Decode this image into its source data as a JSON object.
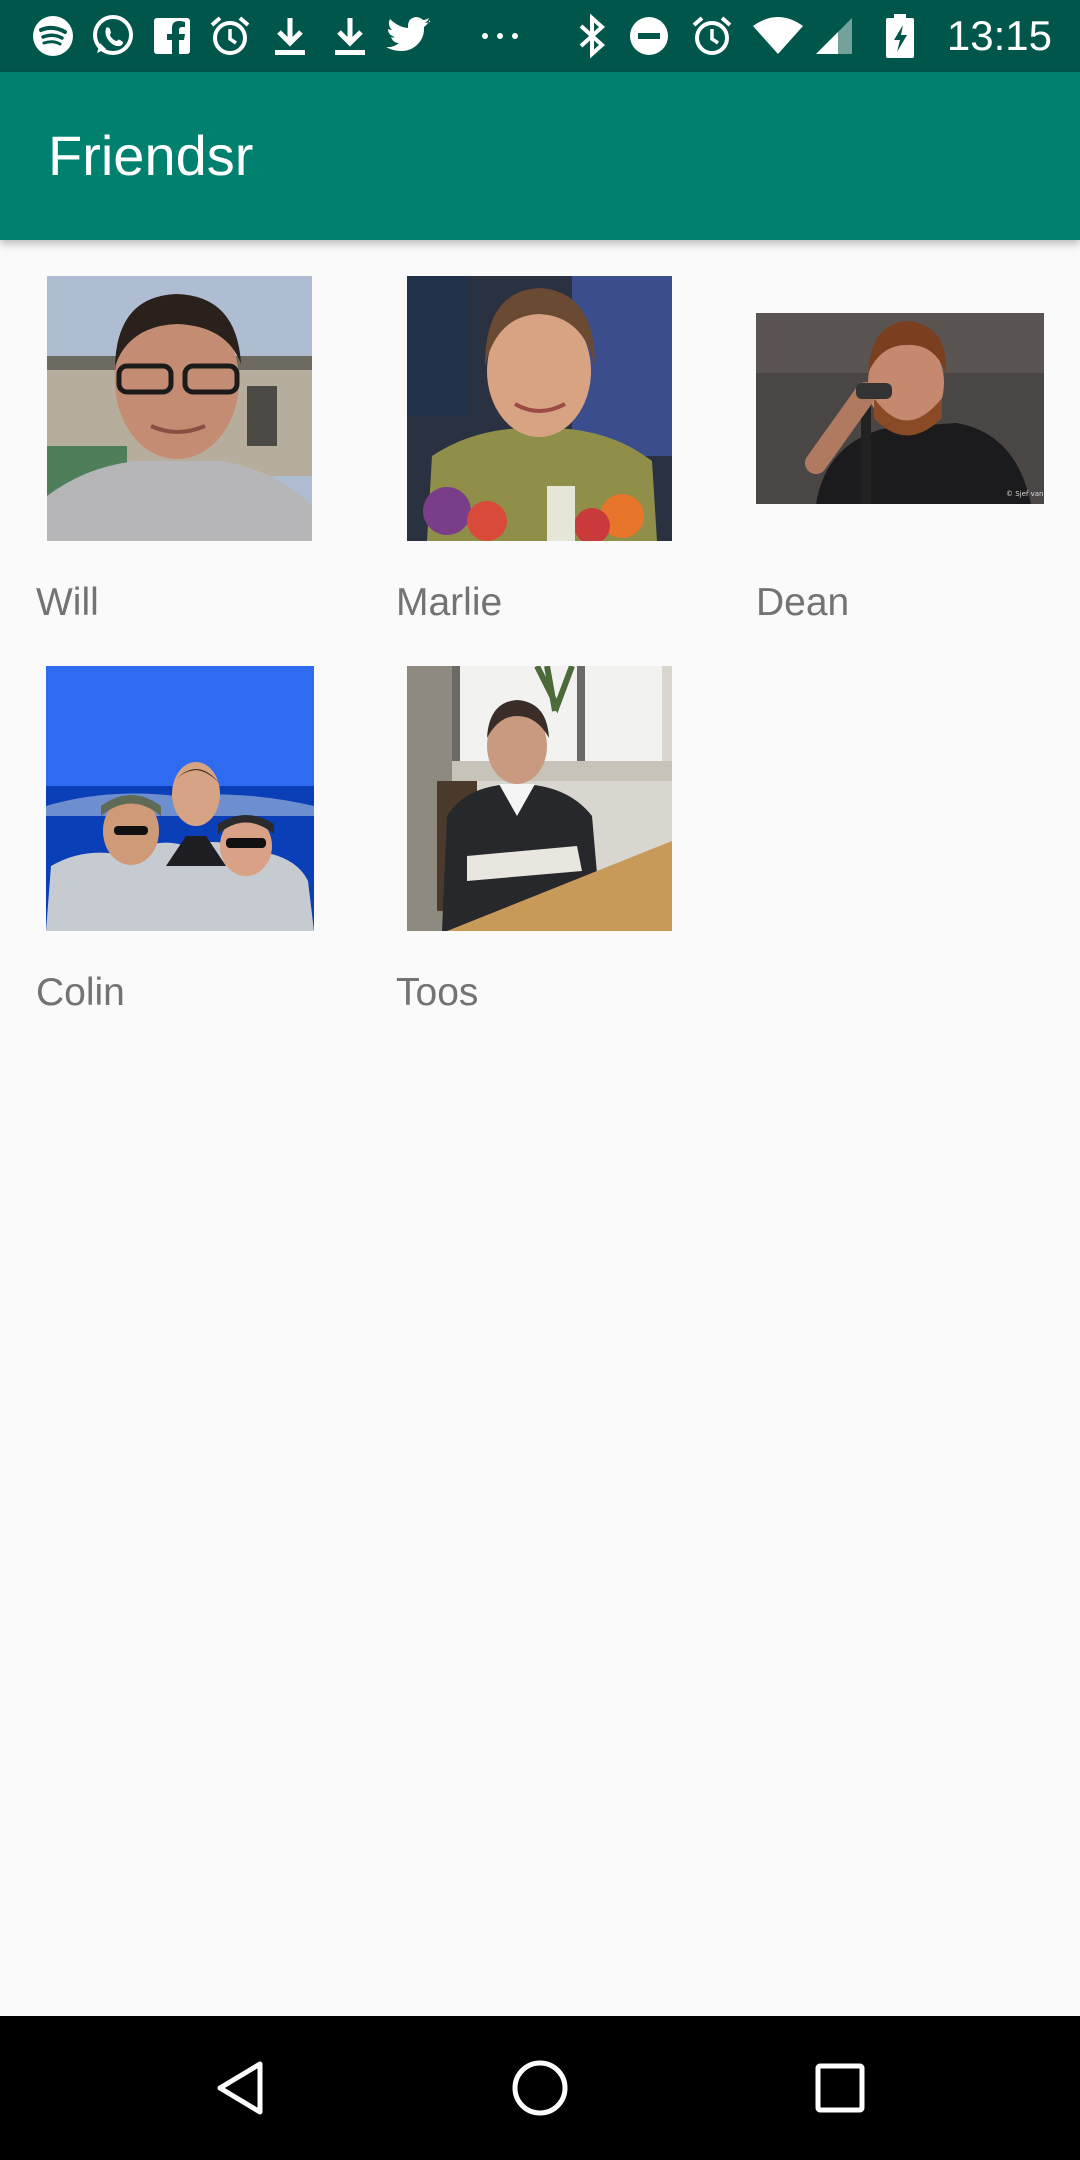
{
  "status_bar": {
    "time": "13:15",
    "left_icons": [
      "spotify-icon",
      "whatsapp-icon",
      "facebook-icon",
      "alarm-icon",
      "download-icon",
      "download-icon",
      "twitter-icon",
      "more-notifications-icon"
    ],
    "right_icons": [
      "bluetooth-icon",
      "do-not-disturb-icon",
      "alarm-icon",
      "wifi-icon",
      "cellular-signal-icon",
      "battery-charging-icon"
    ]
  },
  "app_bar": {
    "title": "Friendsr"
  },
  "friends": [
    {
      "name": "Will"
    },
    {
      "name": "Marlie"
    },
    {
      "name": "Dean"
    },
    {
      "name": "Colin"
    },
    {
      "name": "Toos"
    }
  ],
  "nav_bar": {
    "buttons": [
      "back-icon",
      "home-icon",
      "recents-icon"
    ]
  },
  "colors": {
    "status_bar": "#00564b",
    "app_bar": "#00806f",
    "background": "#fafafa",
    "name_text": "#737373",
    "nav_bar": "#000000"
  }
}
